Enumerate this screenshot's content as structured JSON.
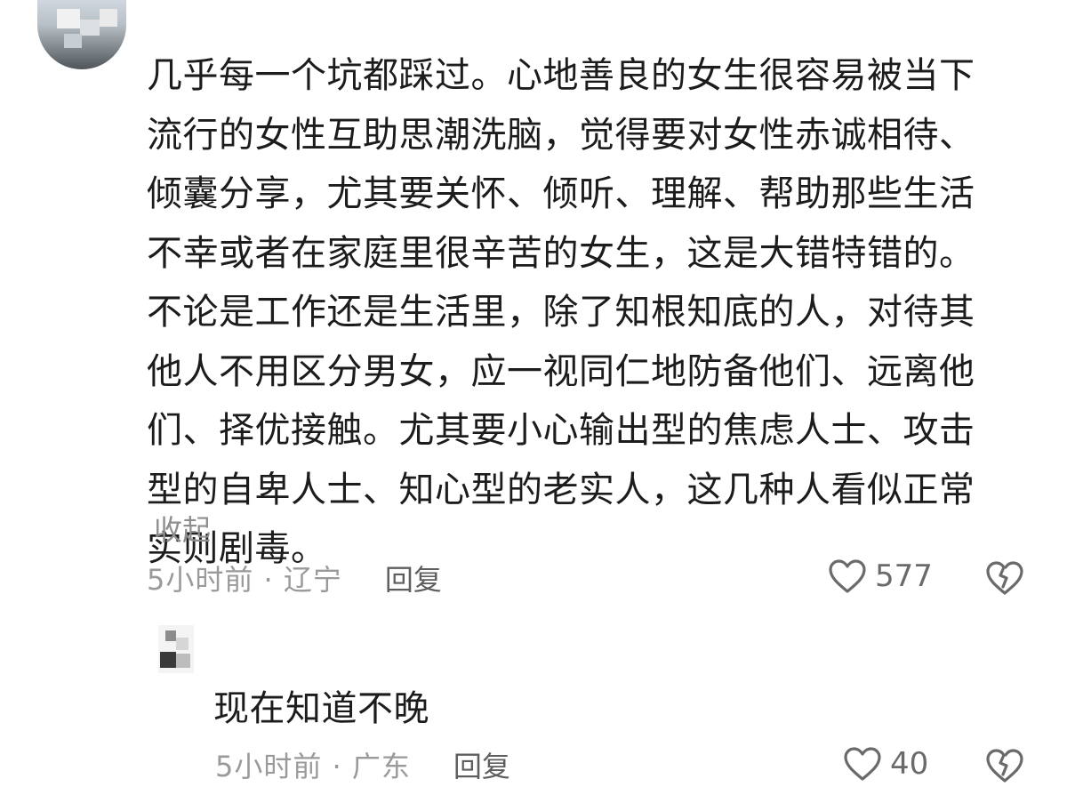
{
  "comment": {
    "text": "几乎每一个坑都踩过。心地善良的女生很容易被当下流行的女性互助思潮洗脑，觉得要对女性赤诚相待、倾囊分享，尤其要关怀、倾听、理解、帮助那些生活不幸或者在家庭里很辛苦的女生，这是大错特错的。不论是工作还是生活里，除了知根知底的人，对待其他人不用区分男女，应一视同仁地防备他们、远离他们、择优接触。尤其要小心输出型的焦虑人士、攻击型的自卑人士、知心型的老实人，这几种人看似正常实则剧毒。",
    "collapse_label": "收起",
    "time_location": "5小时前 · 辽宁",
    "reply_label": "回复",
    "like_count": "577",
    "like_icon": "heart-outline-icon",
    "dislike_icon": "broken-heart-icon"
  },
  "reply": {
    "text": "现在知道不晚",
    "time_location": "5小时前 · 广东",
    "reply_label": "回复",
    "like_count": "40",
    "like_icon": "heart-outline-icon",
    "dislike_icon": "broken-heart-icon"
  },
  "colors": {
    "text": "#1c1c1c",
    "meta": "#9a9a9a",
    "icon": "#6a6a6a"
  }
}
